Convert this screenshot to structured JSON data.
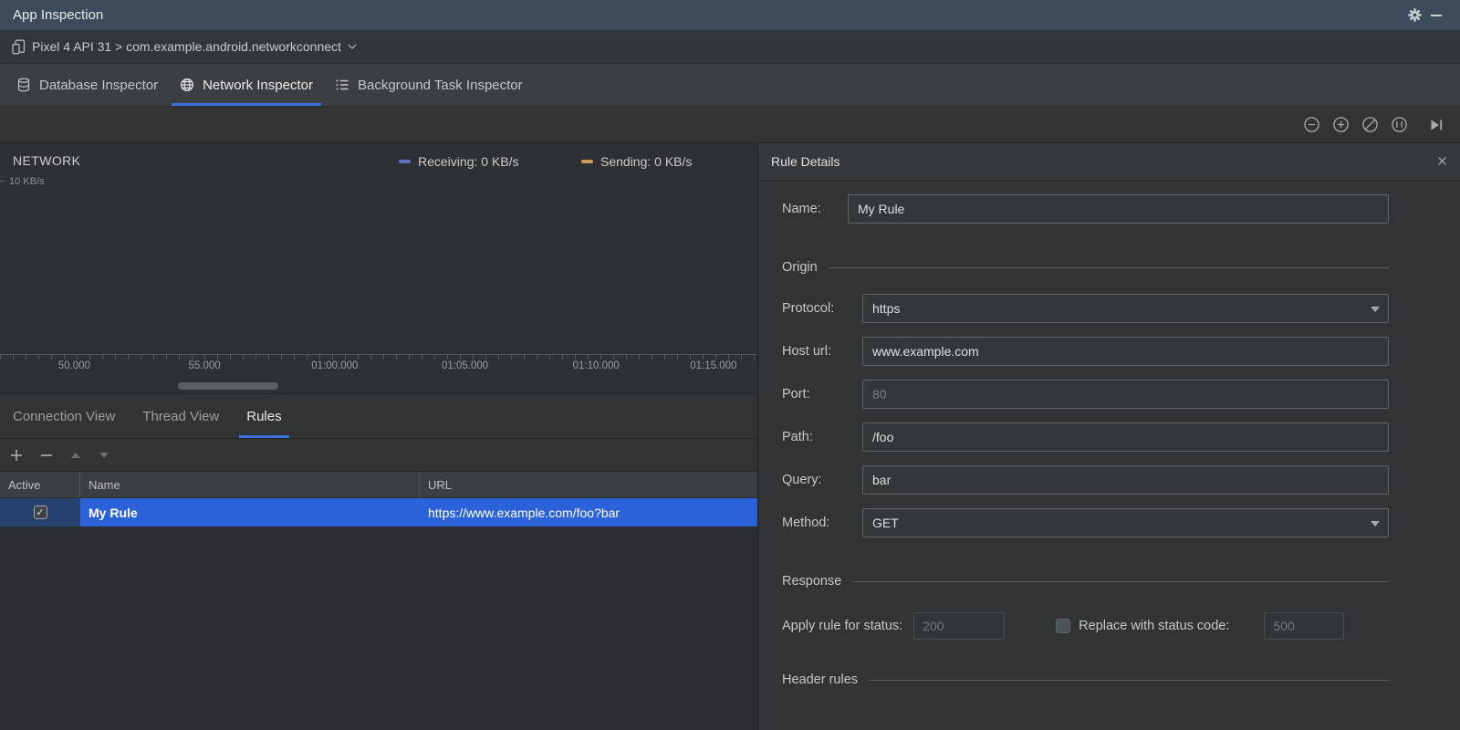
{
  "colors": {
    "accent_blue": "#3B6EDF",
    "selection_blue": "#2B62D9",
    "receiving_color": "#5F74BE",
    "sending_color": "#D39C54",
    "titlebar_bg": "#3D4B5C"
  },
  "icons": {
    "close_glyph": "×",
    "check_glyph": "✓"
  },
  "titlebar": {
    "title": "App Inspection"
  },
  "device_bar": {
    "selector": "Pixel 4 API 31 > com.example.android.networkconnect"
  },
  "inspector_tabs": [
    {
      "label": "Database Inspector",
      "active": false
    },
    {
      "label": "Network Inspector",
      "active": true
    },
    {
      "label": "Background Task Inspector",
      "active": false
    }
  ],
  "zoom_toolbar": {
    "icons": [
      "zoom-out",
      "zoom-in",
      "reset-zoom",
      "zoom-to-selection",
      "go-live"
    ]
  },
  "chart": {
    "title": "NETWORK",
    "y_axis_top_label": "10 KB/s",
    "legend": [
      {
        "label": "Receiving: 0 KB/s"
      },
      {
        "label": "Sending: 0 KB/s"
      }
    ],
    "time_ticks": [
      "50.000",
      "55.000",
      "01:00.000",
      "01:05.000",
      "01:10.000",
      "01:15.000"
    ]
  },
  "view_tabs": [
    {
      "label": "Connection View",
      "active": false
    },
    {
      "label": "Thread View",
      "active": false
    },
    {
      "label": "Rules",
      "active": true
    }
  ],
  "rules_table": {
    "columns": [
      "Active",
      "Name",
      "URL"
    ],
    "rows": [
      {
        "active": true,
        "name": "My Rule",
        "url": "https://www.example.com/foo?bar",
        "selected": true
      }
    ]
  },
  "rule_details": {
    "title": "Rule Details",
    "name": {
      "label": "Name:",
      "value": "My Rule"
    },
    "origin": {
      "section": "Origin",
      "fields": [
        {
          "label": "Protocol:",
          "value": "https",
          "type": "dropdown"
        },
        {
          "label": "Host url:",
          "value": "www.example.com",
          "type": "text"
        },
        {
          "label": "Port:",
          "placeholder": "80",
          "type": "text"
        },
        {
          "label": "Path:",
          "value": "/foo",
          "type": "text"
        },
        {
          "label": "Query:",
          "value": "bar",
          "type": "text"
        },
        {
          "label": "Method:",
          "value": "GET",
          "type": "dropdown"
        }
      ]
    },
    "response": {
      "section": "Response",
      "apply_label": "Apply rule for status:",
      "apply_placeholder": "200",
      "replace_checkbox_checked": false,
      "replace_label": "Replace with status code:",
      "replace_placeholder": "500"
    },
    "header_rules": {
      "section": "Header rules"
    }
  }
}
